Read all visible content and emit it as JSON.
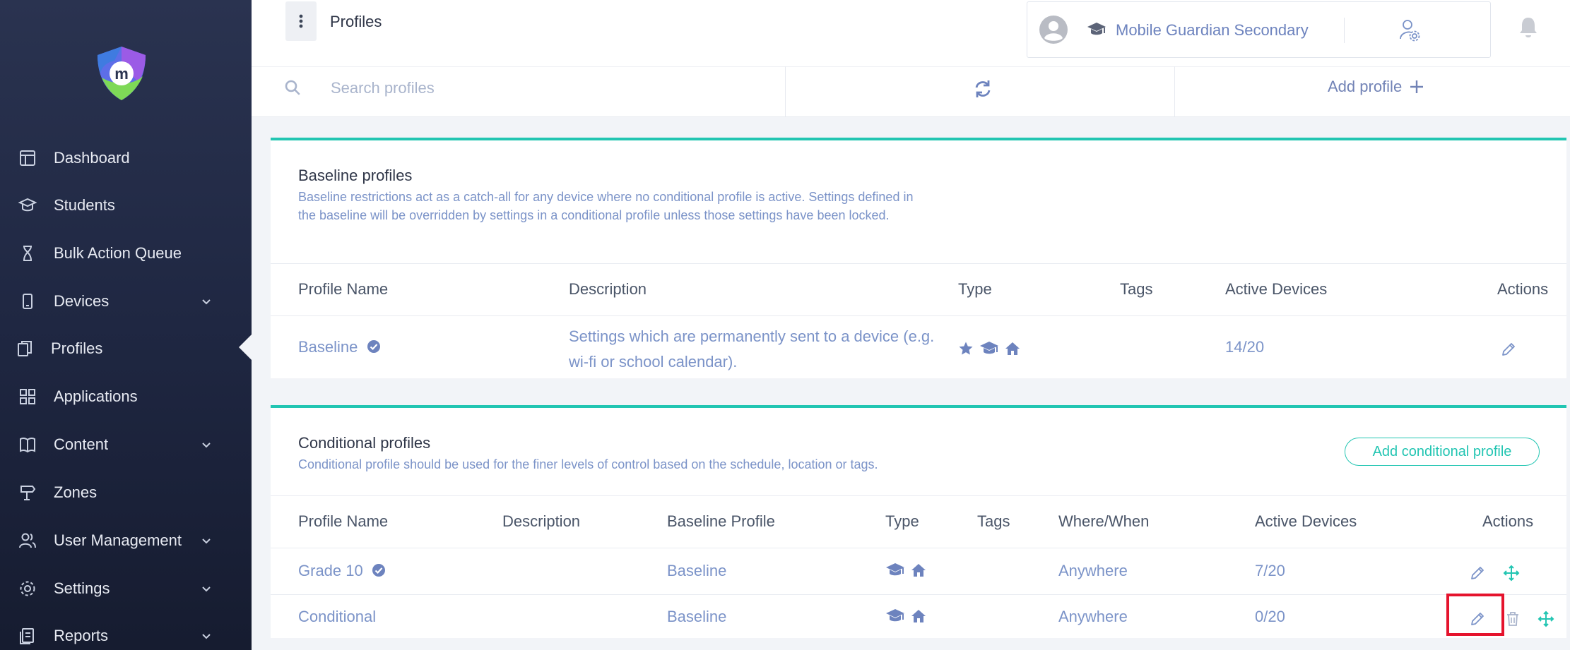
{
  "header": {
    "page_title": "Profiles",
    "school_name": "Mobile Guardian Secondary"
  },
  "sidebar": {
    "items": [
      {
        "label": "Dashboard",
        "icon": "dashboard-icon",
        "has_chevron": false
      },
      {
        "label": "Students",
        "icon": "students-icon",
        "has_chevron": false
      },
      {
        "label": "Bulk Action Queue",
        "icon": "hourglass-icon",
        "has_chevron": false
      },
      {
        "label": "Devices",
        "icon": "device-icon",
        "has_chevron": true
      },
      {
        "label": "Profiles",
        "icon": "profiles-icon",
        "has_chevron": false,
        "active": true
      },
      {
        "label": "Applications",
        "icon": "applications-icon",
        "has_chevron": false
      },
      {
        "label": "Content",
        "icon": "content-icon",
        "has_chevron": true
      },
      {
        "label": "Zones",
        "icon": "zones-icon",
        "has_chevron": false
      },
      {
        "label": "User Management",
        "icon": "users-icon",
        "has_chevron": true
      },
      {
        "label": "Settings",
        "icon": "gear-icon",
        "has_chevron": true
      },
      {
        "label": "Reports",
        "icon": "reports-icon",
        "has_chevron": true
      }
    ]
  },
  "toolbar": {
    "search_placeholder": "Search profiles",
    "add_profile_label": "Add profile"
  },
  "baseline": {
    "title": "Baseline profiles",
    "description": "Baseline restrictions act as a catch-all for any device where no conditional profile is active. Settings defined in the baseline will be overridden by settings in a conditional profile unless those settings have been locked.",
    "columns": {
      "name": "Profile Name",
      "description": "Description",
      "type": "Type",
      "tags": "Tags",
      "active_devices": "Active Devices",
      "actions": "Actions"
    },
    "rows": [
      {
        "name": "Baseline",
        "verified": true,
        "description": "Settings which are permanently sent to a device (e.g. wi-fi or school calendar).",
        "type_icons": [
          "star-icon",
          "graduation-cap-icon",
          "home-icon"
        ],
        "tags": "",
        "active_devices": "14/20"
      }
    ]
  },
  "conditional": {
    "title": "Conditional profiles",
    "description": "Conditional profile should be used for the finer levels of control based on the schedule, location or tags.",
    "add_button_label": "Add conditional profile",
    "columns": {
      "name": "Profile Name",
      "description": "Description",
      "baseline_profile": "Baseline Profile",
      "type": "Type",
      "tags": "Tags",
      "where_when": "Where/When",
      "active_devices": "Active Devices",
      "actions": "Actions"
    },
    "rows": [
      {
        "name": "Grade 10",
        "verified": true,
        "description": "",
        "baseline_profile": "Baseline",
        "type_icons": [
          "graduation-cap-icon",
          "home-icon"
        ],
        "tags": "",
        "where_when": "Anywhere",
        "active_devices": "7/20"
      },
      {
        "name": "Conditional",
        "verified": false,
        "description": "",
        "baseline_profile": "Baseline",
        "type_icons": [
          "graduation-cap-icon",
          "home-icon"
        ],
        "tags": "",
        "where_when": "Anywhere",
        "active_devices": "0/20"
      }
    ]
  },
  "colors": {
    "sidebar_bg": "#1f2742",
    "accent_teal": "#22c5b2",
    "link_blue": "#7b93c8",
    "highlight_red": "#e5132d"
  }
}
